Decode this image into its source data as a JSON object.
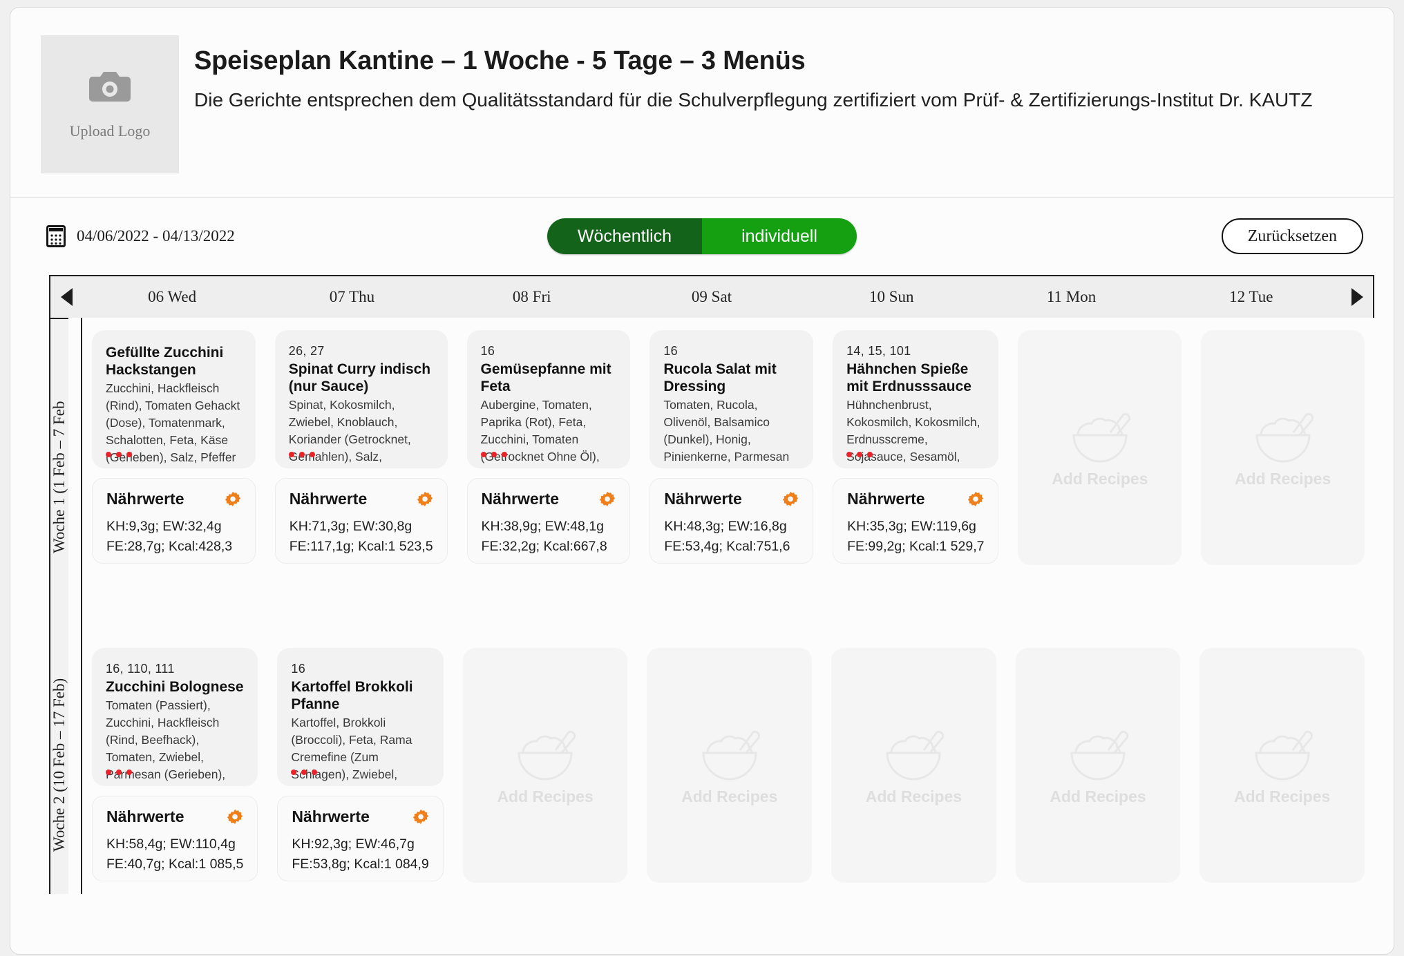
{
  "header": {
    "logo_label": "Upload Logo",
    "logo_icon": "camera-icon",
    "title": "Speiseplan Kantine – 1 Woche - 5 Tage – 3 Menüs",
    "subtitle": "Die Gerichte entsprechen dem Qualitätsstandard für die Schulverpflegung zertifiziert vom Prüf- & Zertifizierungs-Institut Dr. KAUTZ"
  },
  "toolbar": {
    "calendar_icon": "calendar-icon",
    "date_range": "04/06/2022  - 04/13/2022",
    "segment": {
      "weekly_label": "Wöchentlich",
      "individual_label": "individuell",
      "selected": "Wöchentlich",
      "active_color": "#14631a",
      "inactive_color": "#15a012"
    },
    "reset_label": "Zurücksetzen"
  },
  "calendar": {
    "prev_label": "◀",
    "next_label": "▶",
    "days": [
      "06 Wed",
      "07 Thu",
      "08 Fri",
      "09 Sat",
      "10 Sun",
      "11 Mon",
      "12 Tue"
    ],
    "nutrient_title": "Nährwerte",
    "gear_icon": "gear-icon",
    "gear_color": "#ef7f1a",
    "dot_color": "#e8232a",
    "add_recipes_label": "Add Recipes",
    "bowl_icon": "bowl-with-spoon-icon",
    "weeks": [
      {
        "label": "Woche 1 (1 Feb – 7 Feb",
        "cells": [
          {
            "type": "recipe",
            "tags": "",
            "name": "Gefüllte Zucchini Hackstangen",
            "ingredients": "Zucchini, Hackfleisch (Rind), Tomaten Gehackt (Dose), Tomatenmark, Schalotten, Feta, Käse (Gerieben), Salz, Pfeffer (Schwarz), Organo (Getrocknet), Basilikum (Frisch)",
            "dots": 3,
            "nutrients": {
              "line1": "KH:9,3g; EW:32,4g",
              "line2": "FE:28,7g; Kcal:428,3"
            }
          },
          {
            "type": "recipe",
            "tags": "26, 27",
            "name": "Spinat Curry indisch (nur Sauce)",
            "ingredients": "Spinat, Kokosmilch, Zwiebel, Knoblauch, Koriander (Getrocknet, Gemahlen), Salz, Chilipulver, Kreuzkümmel, Kokosöl, Currypulver, Kurkumapulver, Tomaten",
            "dots": 3,
            "nutrients": {
              "line1": "KH:71,3g; EW:30,8g",
              "line2": "FE:117,1g; Kcal:1 523,5"
            }
          },
          {
            "type": "recipe",
            "tags": "16",
            "name": "Gemüsepfanne mit Feta",
            "ingredients": "Aubergine, Tomaten, Paprika (Rot), Feta, Zucchini, Tomaten (Getrocknet Ohne Öl), Quark (Magerstufe, Magerquark), Oregano (Frisch), Basilikum (Frisch), Olivenöl",
            "dots": 3,
            "nutrients": {
              "line1": "KH:38,9g; EW:48,1g",
              "line2": "FE:32,2g; Kcal:667,8"
            }
          },
          {
            "type": "recipe",
            "tags": "16",
            "name": "Rucola Salat mit Dressing",
            "ingredients": "Tomaten, Rucola, Olivenöl, Balsamico (Dunkel), Honig, Pinienkerne, Parmesan (Gerieben), Salz, Pfeffer (Weiß)",
            "dots": 0,
            "nutrients": {
              "line1": "KH:48,3g; EW:16,8g",
              "line2": "FE:53,4g; Kcal:751,6"
            }
          },
          {
            "type": "recipe",
            "tags": "14, 15, 101",
            "name": "Hähnchen Spieße mit Erdnusssauce",
            "ingredients": "Hühnchenbrust, Kokosmilch, Kokosmilch, Erdnusscreme, Sojasauce, Sesamöl, Currypaste, Sojasauce, Currypaste, Zitronengras (Getrocknet), Limette, Knoblauch",
            "dots": 3,
            "nutrients": {
              "line1": "KH:35,3g; EW:119,6g",
              "line2": "FE:99,2g; Kcal:1 529,7"
            }
          },
          {
            "type": "placeholder"
          },
          {
            "type": "placeholder"
          }
        ]
      },
      {
        "label": "Woche 2 (10 Feb – 17 Feb)",
        "cells": [
          {
            "type": "recipe",
            "tags": "16, 110, 111",
            "name": "Zucchini Bolognese",
            "ingredients": "Tomaten (Passiert), Zucchini, Hackfleisch (Rind, Beefhack), Tomaten, Zwiebel, Parmesan (Gerieben), Tomatenmark, Oregano (Frisch), Xucker (Xylit), Knoblauch, Basilikum (Frisch), Rosmarin (Frisch)",
            "dots": 3,
            "nutrients": {
              "line1": "KH:58,4g; EW:110,4g",
              "line2": "FE:40,7g; Kcal:1 085,5"
            }
          },
          {
            "type": "recipe",
            "tags": "16",
            "name": "Kartoffel Brokkoli Pfanne",
            "ingredients": "Kartoffel, Brokkoli (Broccoli), Feta, Rama Cremefine (Zum Schlagen), Zwiebel, Frischkäse, Pinienkerne, Salz, Pfeffer (Weiß), Tomaten",
            "dots": 3,
            "nutrients": {
              "line1": "KH:92,3g; EW:46,7g",
              "line2": "FE:53,8g; Kcal:1 084,9"
            }
          },
          {
            "type": "placeholder"
          },
          {
            "type": "placeholder"
          },
          {
            "type": "placeholder"
          },
          {
            "type": "placeholder"
          },
          {
            "type": "placeholder"
          }
        ]
      }
    ]
  }
}
